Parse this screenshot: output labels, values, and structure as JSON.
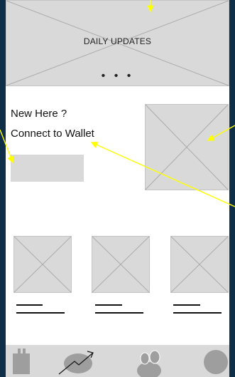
{
  "banner": {
    "title": "DAILY UPDATES",
    "pager": "• • •"
  },
  "onboarding": {
    "greeting": "New Here ?",
    "connect_label": "Connect to Wallet"
  },
  "colors": {
    "background": "#0f2f49",
    "placeholder": "#d9d9d9",
    "annotation": "#ffff00",
    "text": "#111111"
  },
  "bottom_nav": {
    "items": [
      {
        "icon": "bag-icon"
      },
      {
        "icon": "trending-chart-icon"
      },
      {
        "icon": "users-icon"
      },
      {
        "icon": "profile-icon"
      }
    ]
  }
}
